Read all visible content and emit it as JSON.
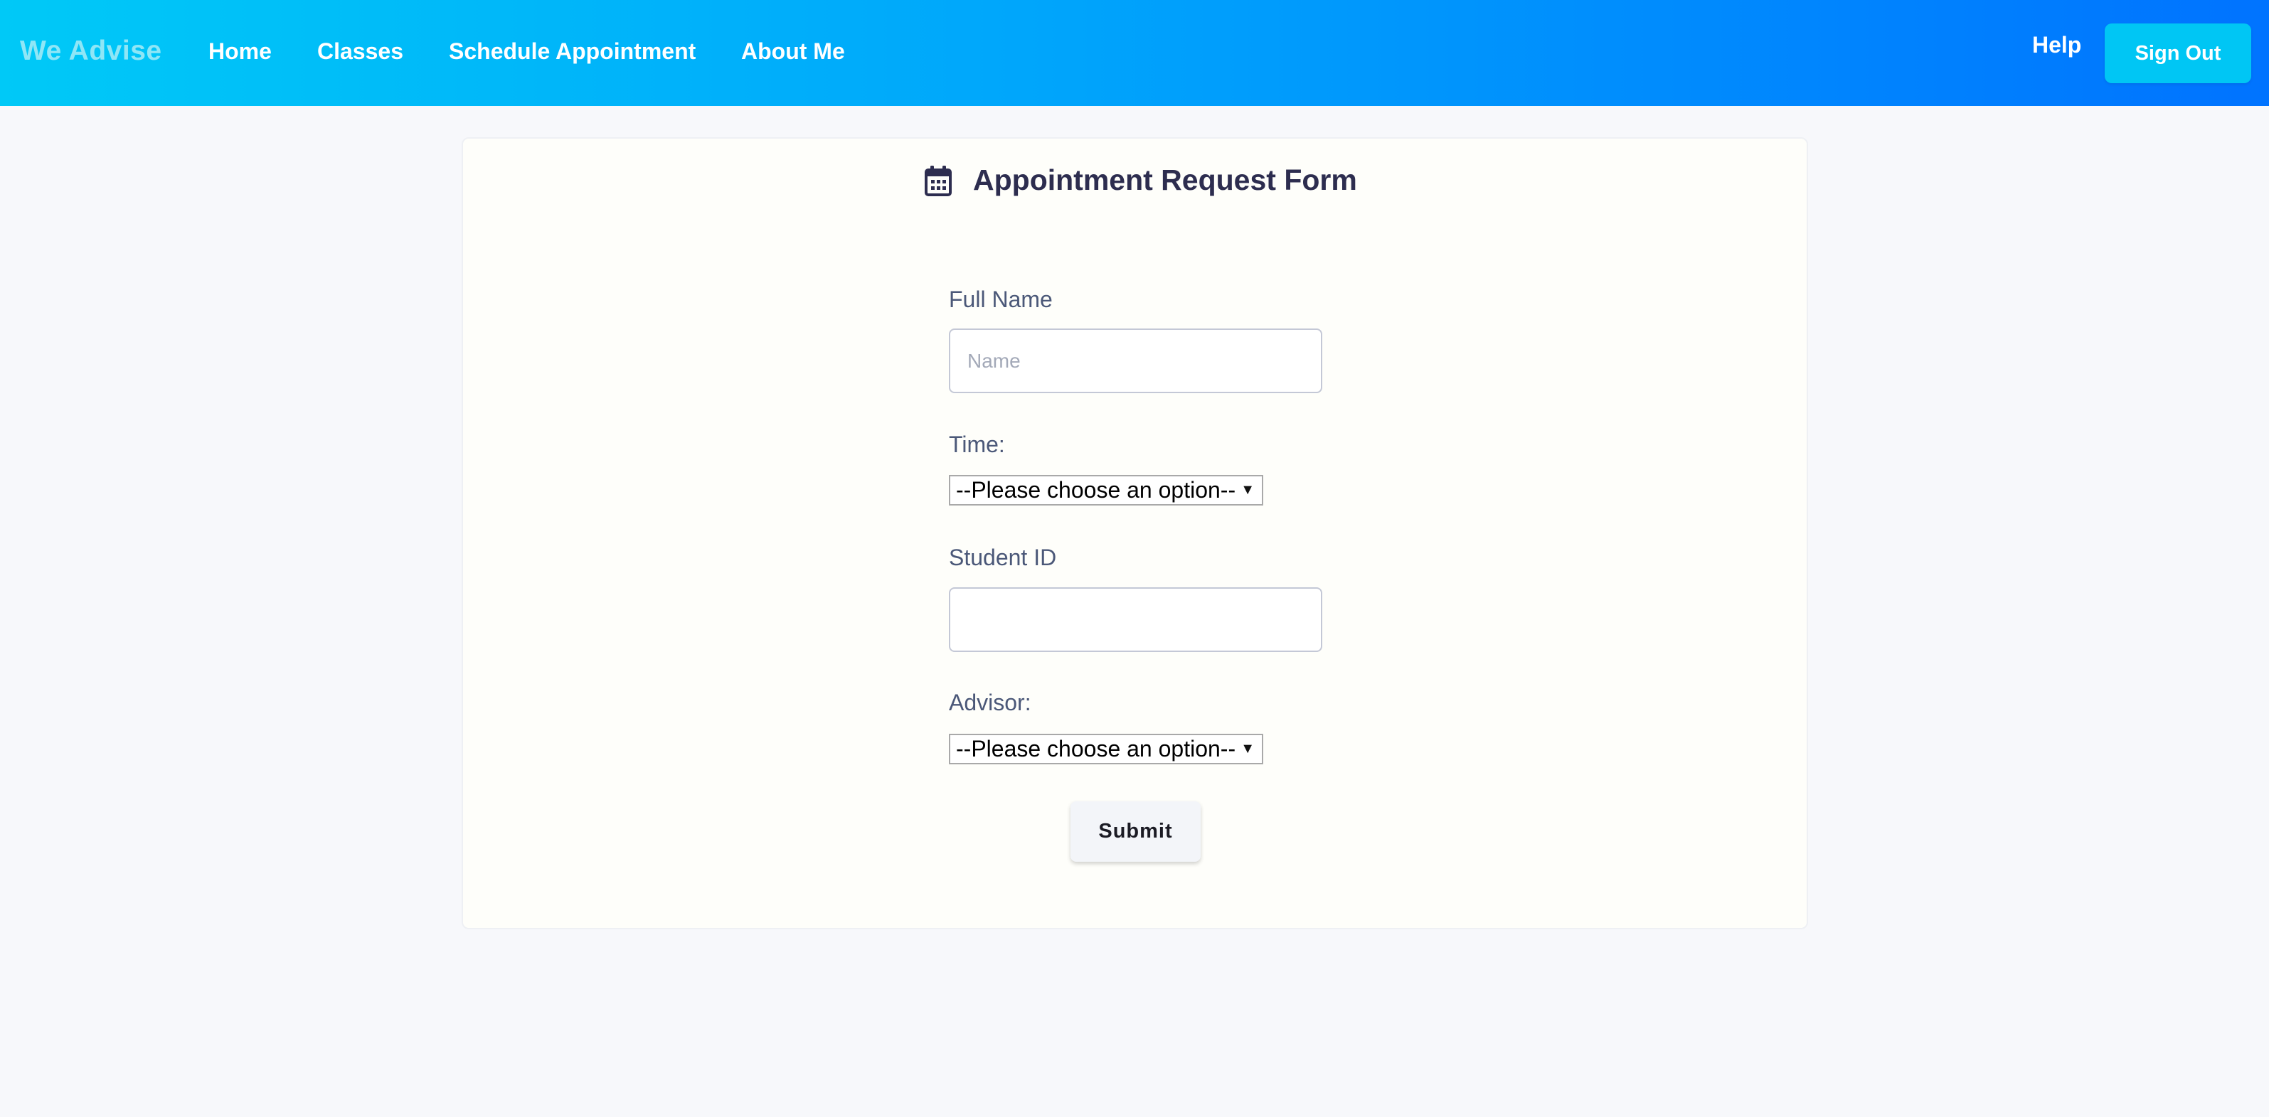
{
  "nav": {
    "brand": "We Advise",
    "links": [
      "Home",
      "Classes",
      "Schedule Appointment",
      "About Me"
    ],
    "help": "Help",
    "sign_out": "Sign Out"
  },
  "form": {
    "title": "Appointment Request Form",
    "title_icon": "calendar-icon",
    "full_name": {
      "label": "Full Name",
      "placeholder": "Name",
      "value": ""
    },
    "time": {
      "label": "Time:",
      "selected": "--Please choose an option--"
    },
    "student_id": {
      "label": "Student ID",
      "placeholder": "",
      "value": ""
    },
    "advisor": {
      "label": "Advisor:",
      "selected": "--Please choose an option--"
    },
    "submit_label": "Submit"
  },
  "colors": {
    "nav_gradient_start": "#00c9f7",
    "nav_gradient_end": "#0073ff",
    "sign_out_bg": "#00c6f4",
    "brand_text": "#8fe6f6",
    "page_bg": "#f7f8fb",
    "title_text": "#2d2d4f",
    "label_text": "#4b5878"
  }
}
